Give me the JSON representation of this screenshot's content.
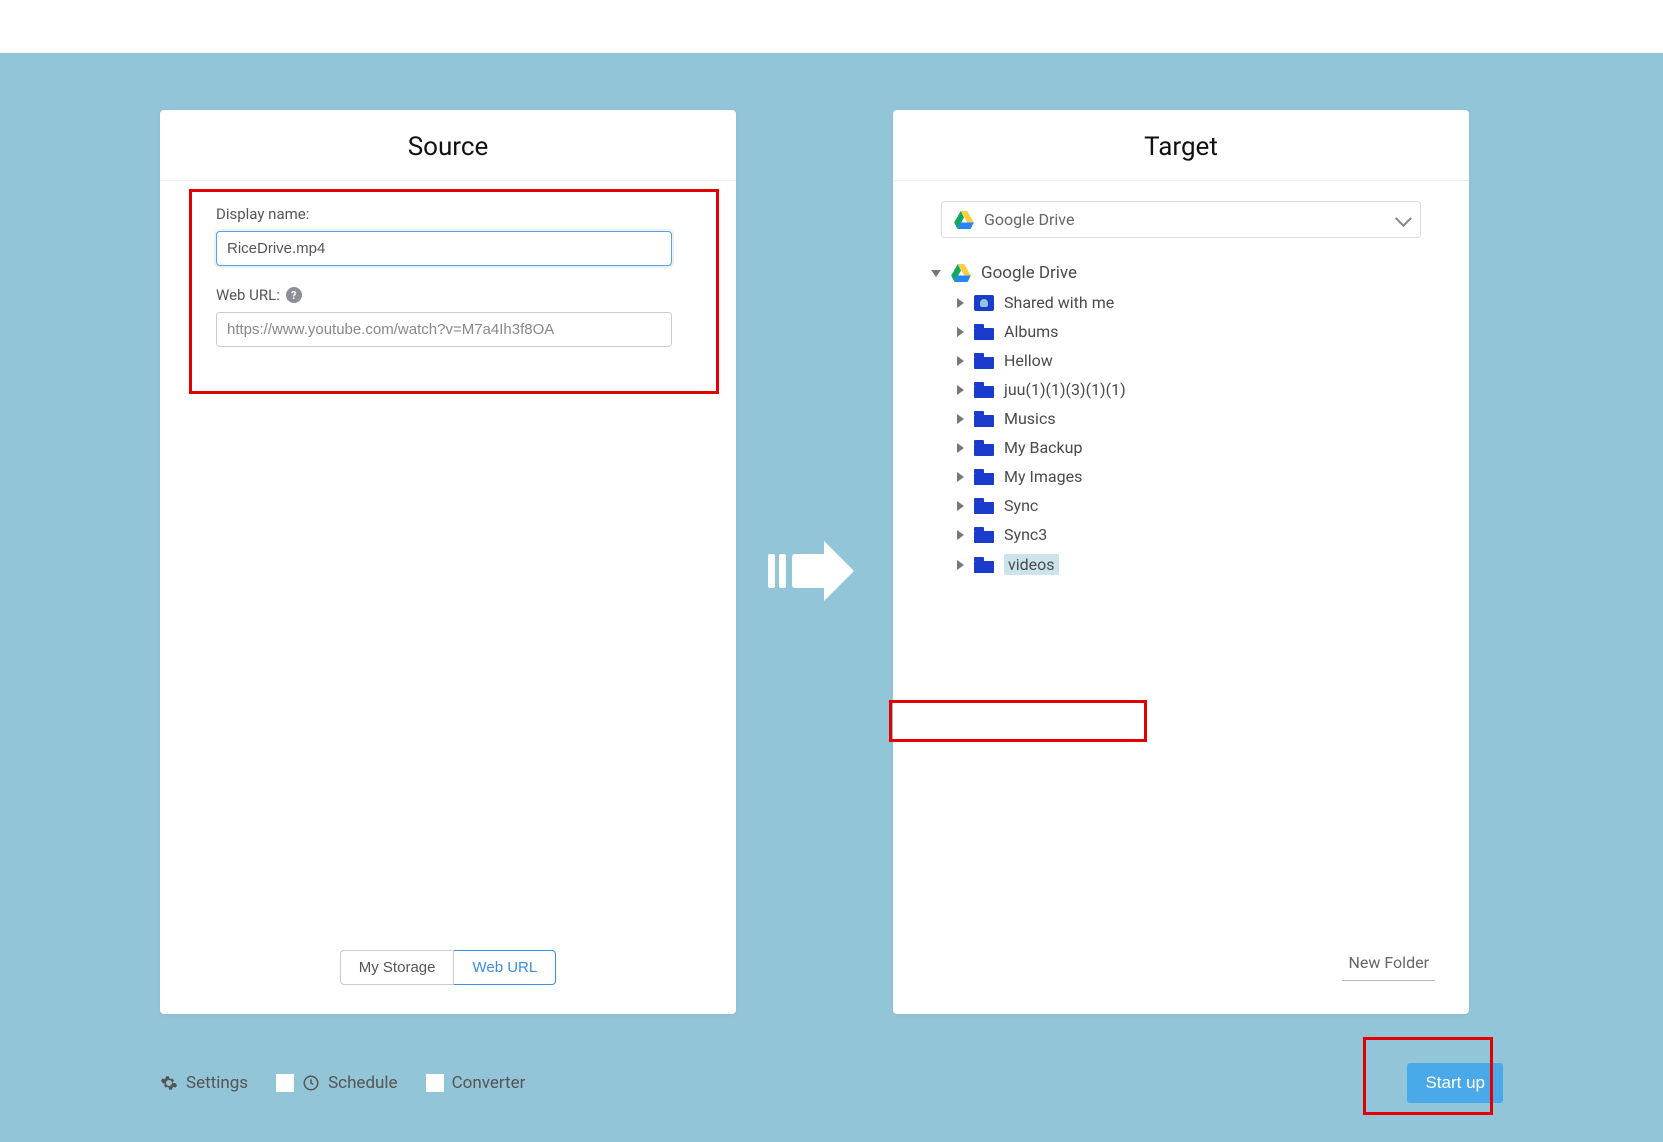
{
  "source": {
    "title": "Source",
    "display_name_label": "Display name:",
    "display_name_value": "RiceDrive.mp4",
    "web_url_label": "Web URL:",
    "web_url_value": "https://www.youtube.com/watch?v=M7a4Ih3f8OA",
    "tabs": {
      "my_storage": "My Storage",
      "web_url": "Web URL"
    }
  },
  "target": {
    "title": "Target",
    "dropdown_selected": "Google Drive",
    "root_label": "Google Drive",
    "folders": [
      {
        "label": "Shared with me",
        "icon": "shared"
      },
      {
        "label": "Albums",
        "icon": "folder"
      },
      {
        "label": "Hellow",
        "icon": "folder"
      },
      {
        "label": "juu(1)(1)(3)(1)(1)",
        "icon": "folder"
      },
      {
        "label": "Musics",
        "icon": "folder"
      },
      {
        "label": "My Backup",
        "icon": "folder"
      },
      {
        "label": "My Images",
        "icon": "folder"
      },
      {
        "label": "Sync",
        "icon": "folder"
      },
      {
        "label": "Sync3",
        "icon": "folder"
      },
      {
        "label": "videos",
        "icon": "folder",
        "selected": true
      }
    ],
    "new_folder": "New Folder"
  },
  "bottom": {
    "settings": "Settings",
    "schedule": "Schedule",
    "converter": "Converter",
    "start": "Start up"
  }
}
